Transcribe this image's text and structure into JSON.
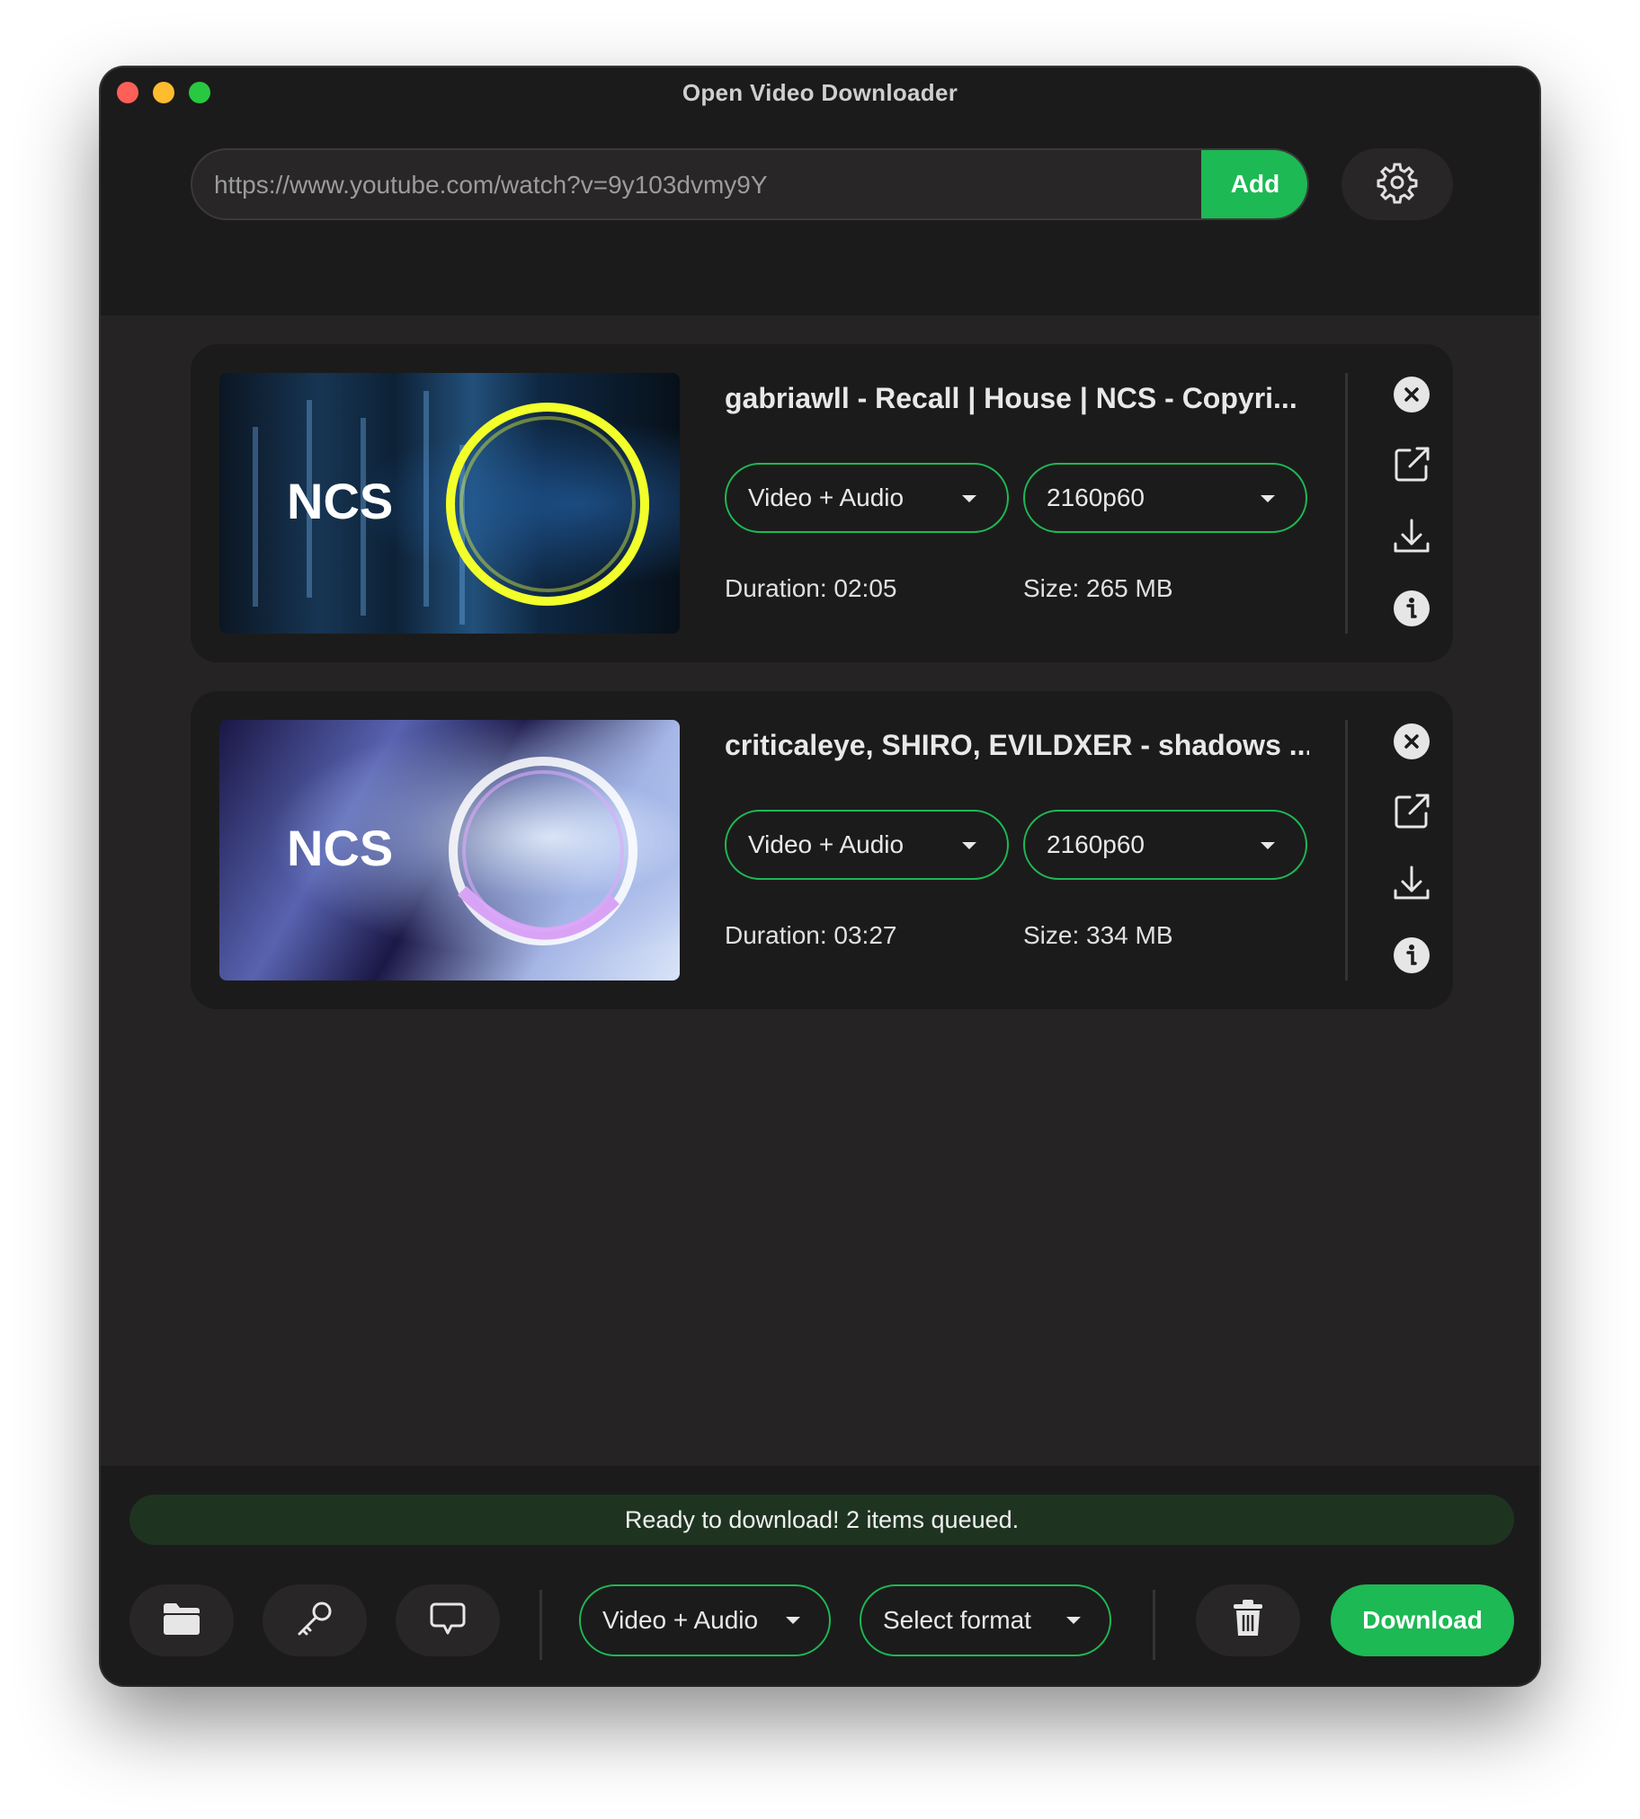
{
  "window": {
    "title": "Open Video Downloader"
  },
  "toolbar": {
    "url_value": "https://www.youtube.com/watch?v=9y103dvmy9Y",
    "add_label": "Add",
    "settings_icon": "gear-icon"
  },
  "items": [
    {
      "title": "gabriawll - Recall | House | NCS - Copyri...",
      "thumbnail_text": "NCS",
      "type": "Video + Audio",
      "quality": "2160p60",
      "duration": "Duration: 02:05",
      "size": "Size: 265 MB"
    },
    {
      "title": "criticaleye, SHIRO, EVILDXER - shadows ...",
      "thumbnail_text": "NCS",
      "type": "Video + Audio",
      "quality": "2160p60",
      "duration": "Duration: 03:27",
      "size": "Size: 334 MB"
    }
  ],
  "item_actions": [
    "close-icon",
    "open-external-icon",
    "download-icon",
    "info-icon"
  ],
  "status": {
    "text": "Ready to download! 2 items queued."
  },
  "bottom": {
    "icons": [
      "folder-icon",
      "key-icon",
      "chat-icon",
      "trash-icon"
    ],
    "type_select": "Video + Audio",
    "format_select": "Select format",
    "download_label": "Download"
  },
  "colors": {
    "accent": "#1db954",
    "window_bg": "#252323",
    "panel_bg": "#1c1b1b",
    "status_bg": "#1e3420"
  }
}
